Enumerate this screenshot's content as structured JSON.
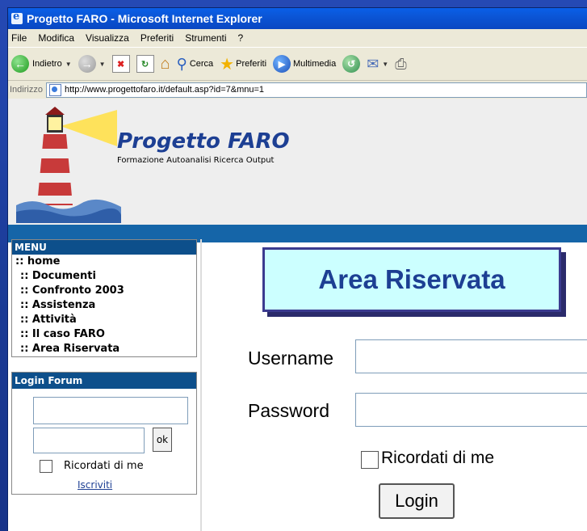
{
  "window": {
    "title": "Progetto FARO - Microsoft Internet Explorer"
  },
  "menubar": [
    "File",
    "Modifica",
    "Visualizza",
    "Preferiti",
    "Strumenti",
    "?"
  ],
  "toolbar": {
    "back_label": "Indietro",
    "search_label": "Cerca",
    "favorites_label": "Preferiti",
    "media_label": "Multimedia"
  },
  "address": {
    "label": "Indirizzo",
    "url": "http://www.progettofaro.it/default.asp?id=7&mnu=1"
  },
  "site": {
    "title": "Progetto FARO",
    "subtitle": "Formazione Autoanalisi Ricerca Output"
  },
  "menu": {
    "header": "MENU",
    "items": [
      ":: home",
      ":: Documenti",
      ":: Confronto 2003",
      ":: Assistenza",
      ":: Attività",
      ":: Il caso FARO",
      ":: Area Riservata"
    ]
  },
  "forum": {
    "header": "Login Forum",
    "ok_label": "ok",
    "remember_label": "Ricordati di me",
    "register_label": "Iscriviti"
  },
  "area": {
    "title": "Area Riservata",
    "username_label": "Username",
    "password_label": "Password",
    "remember_label": "Ricordati di me",
    "login_label": "Login"
  },
  "colors": {
    "title_blue": "#1d3f93",
    "header_bar": "#0d4f8b",
    "area_box": "#ccffff"
  }
}
